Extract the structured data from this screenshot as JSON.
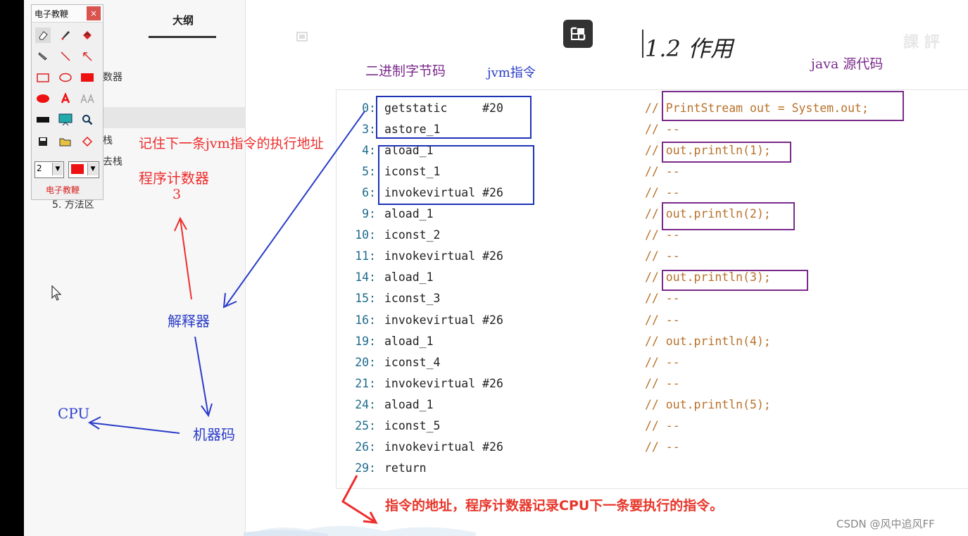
{
  "toolbox": {
    "title": "电子教鞭",
    "close": "×",
    "pen_size": "2",
    "bottom_label": "电子教鞭"
  },
  "outline": {
    "title": "大纲",
    "fragments": [
      "数器",
      "栈",
      "去栈",
      "5. 方法区"
    ]
  },
  "slide": {
    "section_title": "1.2 作用",
    "label_bytecode": "二进制字节码",
    "label_jvm": "jvm指令",
    "label_java": "java 源代码"
  },
  "annotations": {
    "remember_next": "记住下一条jvm指令的执行地址",
    "pc_register": "程序计数器",
    "pc_value": "3",
    "interpreter": "解释器",
    "machine_code": "机器码",
    "cpu": "CPU",
    "bottom_note": "指令的地址，程序计数器记录CPU下一条要执行的指令。"
  },
  "bytecode": [
    {
      "addr": "0:",
      "instr": "getstatic     #20",
      "comment": "// PrintStream out = System.out;"
    },
    {
      "addr": "3:",
      "instr": "astore_1",
      "comment": "// --"
    },
    {
      "addr": "4:",
      "instr": "aload_1",
      "comment": "// out.println(1);"
    },
    {
      "addr": "5:",
      "instr": "iconst_1",
      "comment": "// --"
    },
    {
      "addr": "6:",
      "instr": "invokevirtual #26",
      "comment": "// --"
    },
    {
      "addr": "9:",
      "instr": "aload_1",
      "comment": "// out.println(2);"
    },
    {
      "addr": "10:",
      "instr": "iconst_2",
      "comment": "// --"
    },
    {
      "addr": "11:",
      "instr": "invokevirtual #26",
      "comment": "// --"
    },
    {
      "addr": "14:",
      "instr": "aload_1",
      "comment": "// out.println(3);"
    },
    {
      "addr": "15:",
      "instr": "iconst_3",
      "comment": "// --"
    },
    {
      "addr": "16:",
      "instr": "invokevirtual #26",
      "comment": "// --"
    },
    {
      "addr": "19:",
      "instr": "aload_1",
      "comment": "// out.println(4);"
    },
    {
      "addr": "20:",
      "instr": "iconst_4",
      "comment": "// --"
    },
    {
      "addr": "21:",
      "instr": "invokevirtual #26",
      "comment": "// --"
    },
    {
      "addr": "24:",
      "instr": "aload_1",
      "comment": "// out.println(5);"
    },
    {
      "addr": "25:",
      "instr": "iconst_5",
      "comment": "// --"
    },
    {
      "addr": "26:",
      "instr": "invokevirtual #26",
      "comment": "// --"
    },
    {
      "addr": "29:",
      "instr": "return",
      "comment": ""
    }
  ],
  "watermark": "CSDN @风中追风FF",
  "colors": {
    "annot_red": "#ee2d2d",
    "annot_blue": "#2a3cc8",
    "annot_purple": "#7a2a8a",
    "comment": "#b8712a",
    "address": "#1f6b8c"
  }
}
